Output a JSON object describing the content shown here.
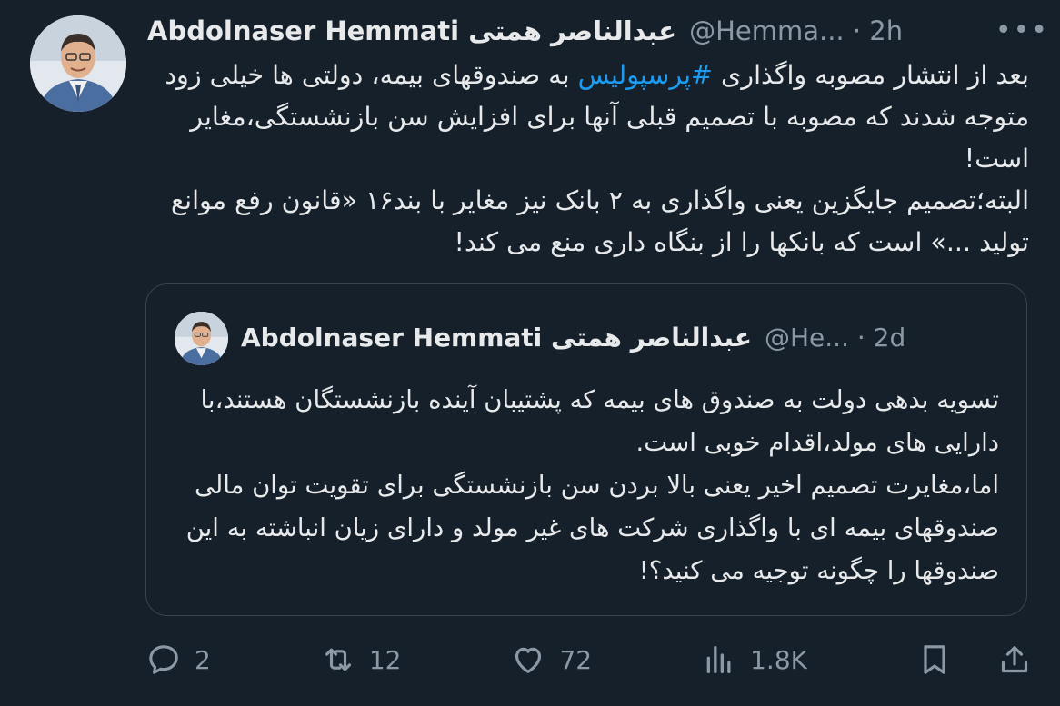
{
  "tweet": {
    "author_name": "Abdolnaser Hemmati عبدالناصر همتی",
    "handle": "@Hemma...",
    "time": "· 2h",
    "more_label": "•••",
    "body": {
      "line1_a": "بعد از انتشار مصوبه واگذاری ",
      "hashtag": "#پرسپولیس",
      "line1_b": " به صندوقهای بیمه، دولتی ها خیلی زود متوجه شدند که مصوبه با تصمیم قبلی آنها برای افزایش سن بازنشستگی،مغایر است!",
      "paragraph2": "البته؛تصمیم جایگزین یعنی واگذاری به ۲ بانک نیز مغایر با بند۱۶ «قانون رفع موانع تولید ...» است که بانکها را از بنگاه داری منع می کند!"
    }
  },
  "quoted": {
    "author_name": "Abdolnaser Hemmati عبدالناصر همتی",
    "handle": "@He...",
    "time": "· 2d",
    "paragraph1": "تسویه بدهی دولت به صندوق های بیمه که پشتیبان آینده بازنشستگان هستند،با دارایی های مولد،اقدام خوبی است.",
    "paragraph2": "اما،مغایرت تصمیم اخیر یعنی بالا بردن سن بازنشستگی برای تقویت توان مالی صندوقهای بیمه ای با واگذاری شرکت های غیر مولد و دارای زیان انباشته به این صندوقها را چگونه توجیه می کنید؟!"
  },
  "actions": {
    "replies": "2",
    "retweets": "12",
    "likes": "72",
    "views": "1.8K"
  },
  "icons": [
    "reply-icon",
    "retweet-icon",
    "like-icon",
    "views-icon",
    "bookmark-icon",
    "share-icon",
    "more-icon"
  ],
  "colors": {
    "background": "#15202b",
    "text": "#e7e9ea",
    "secondary": "#8b98a5",
    "link": "#1d9bf0",
    "border": "#38444d"
  }
}
